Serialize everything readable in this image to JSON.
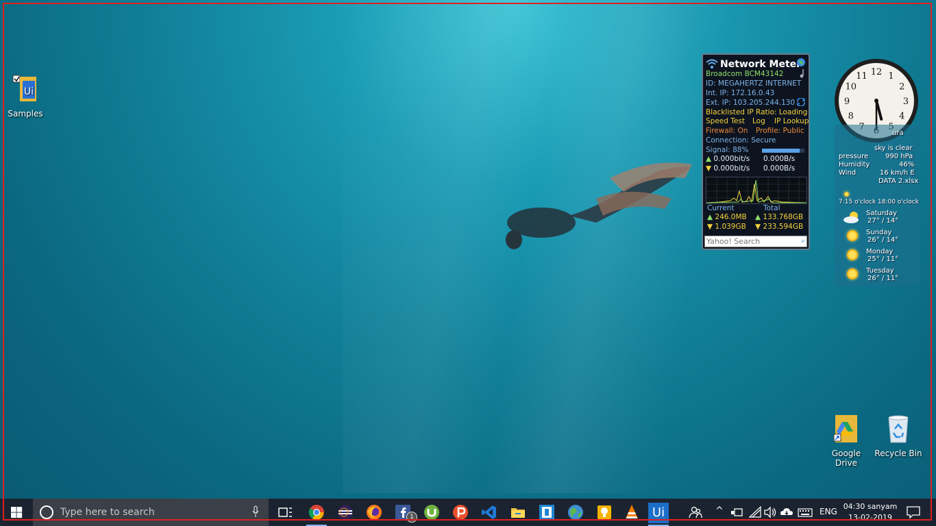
{
  "desktop": {
    "icons": [
      {
        "label": "Samples"
      },
      {
        "label": "Google Drive"
      },
      {
        "label": "Recycle Bin"
      }
    ]
  },
  "network_meter": {
    "title": "Network Meter",
    "adapter": "Broadcom BCM43142",
    "id": "ID: MEGAHERTZ INTERNET",
    "int_ip": "Int. IP: 172.16.0.43",
    "ext_ip": "Ext. IP: 103.205.244.130",
    "blacklist": "Blacklisted IP Ratio: Loading",
    "speed_test": "Speed Test",
    "log": "Log",
    "ip_lookup": "IP Lookup",
    "firewall": "Firewall: On",
    "profile": "Profile: Public",
    "connection": "Connection: Secure",
    "signal": "Signal: 88%",
    "signal_level": 0.88,
    "up_bits": "0.000bit/s",
    "up_bytes": "0.000B/s",
    "down_bits": "0.000bit/s",
    "down_bytes": "0.000B/s",
    "current_label": "Current",
    "total_label": "Total",
    "current_up": "246.0MB",
    "current_down": "1.039GB",
    "total_up": "133.768GB",
    "total_down": "233.594GB",
    "search_placeholder": "Yahoo! Search"
  },
  "clock": {
    "hour": 5,
    "minute": 30
  },
  "weather": {
    "location_fragment": "ura",
    "sky": "sky is clear",
    "pressure_label": "pressure",
    "pressure": "990 hPa",
    "humidity_label": "Humidity",
    "humidity": "46%",
    "wind_label": "Wind",
    "wind": "16 km/h E",
    "file_overlay": "DATA 2.xlsx",
    "sunrise": "7:15 o'clock 18:00 o'clock",
    "forecast": [
      {
        "day": "Saturday",
        "temp": "27° / 14°"
      },
      {
        "day": "Sunday",
        "temp": "26° / 14°"
      },
      {
        "day": "Monday",
        "temp": "25° / 11°"
      },
      {
        "day": "Tuesday",
        "temp": "26° / 11°"
      }
    ]
  },
  "taskbar": {
    "search_placeholder": "Type here to search",
    "fb_badge": "1",
    "language": "ENG",
    "time": "04:30 sanyam",
    "date": "13-02-2019"
  }
}
